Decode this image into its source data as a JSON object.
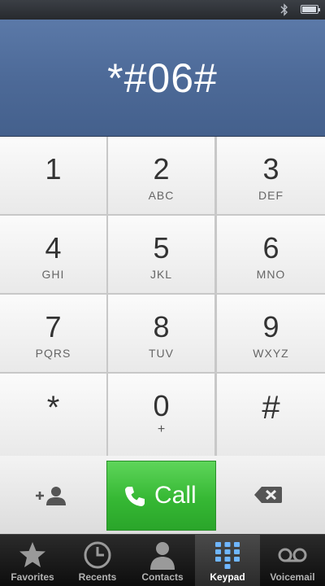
{
  "display": {
    "number": "*#06#"
  },
  "keypad": {
    "keys": [
      {
        "digit": "1",
        "letters": ""
      },
      {
        "digit": "2",
        "letters": "ABC"
      },
      {
        "digit": "3",
        "letters": "DEF"
      },
      {
        "digit": "4",
        "letters": "GHI"
      },
      {
        "digit": "5",
        "letters": "JKL"
      },
      {
        "digit": "6",
        "letters": "MNO"
      },
      {
        "digit": "7",
        "letters": "PQRS"
      },
      {
        "digit": "8",
        "letters": "TUV"
      },
      {
        "digit": "9",
        "letters": "WXYZ"
      },
      {
        "digit": "*",
        "letters": ""
      },
      {
        "digit": "0",
        "letters": "+"
      },
      {
        "digit": "#",
        "letters": ""
      }
    ]
  },
  "actions": {
    "add_contact_icon": "add-contact-icon",
    "call_label": "Call",
    "delete_icon": "backspace-icon"
  },
  "tab_bar": {
    "tabs": [
      {
        "label": "Favorites",
        "icon": "star-icon"
      },
      {
        "label": "Recents",
        "icon": "clock-icon"
      },
      {
        "label": "Contacts",
        "icon": "person-icon"
      },
      {
        "label": "Keypad",
        "icon": "keypad-icon",
        "active": true
      },
      {
        "label": "Voicemail",
        "icon": "voicemail-icon"
      }
    ]
  },
  "colors": {
    "display_blue": "#4d6a98",
    "call_green": "#36b834",
    "tab_bar": "#1a1a1a"
  }
}
